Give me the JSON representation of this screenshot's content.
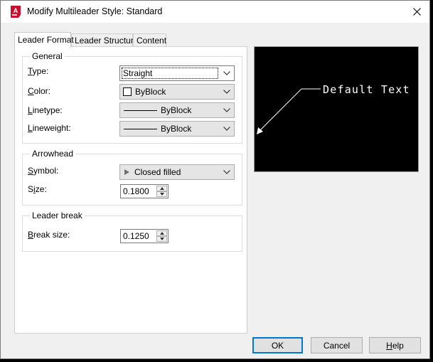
{
  "window": {
    "title": "Modify Multileader Style: Standard",
    "app_icon": "autocad-icon",
    "accent_color": "#c8102e"
  },
  "tabs": [
    {
      "label": "Leader Format",
      "active": true
    },
    {
      "label": "Leader Structure",
      "active": false
    },
    {
      "label": "Content",
      "active": false
    }
  ],
  "general": {
    "title": "General",
    "type": {
      "label": "Type:",
      "mnemonic": "T",
      "rest": "ype:",
      "value": "Straight"
    },
    "color": {
      "label": "Color:",
      "mnemonic": "C",
      "rest": "olor:",
      "value": "ByBlock"
    },
    "linetype": {
      "label": "Linetype:",
      "mnemonic": "L",
      "rest": "inetype:",
      "value": "ByBlock"
    },
    "lineweight": {
      "label": "Lineweight:",
      "mnemonic": "L",
      "rest": "ineweight:",
      "value": "ByBlock"
    }
  },
  "arrowhead": {
    "title": "Arrowhead",
    "symbol": {
      "label": "Symbol:",
      "mnemonic": "S",
      "rest": "ymbol:",
      "value": "Closed filled"
    },
    "size": {
      "label": "Size:",
      "pre": "S",
      "mnemonic": "i",
      "rest": "ze:",
      "value": "0.1800"
    }
  },
  "leader_break": {
    "title": "Leader break",
    "break_size": {
      "label": "Break size:",
      "mnemonic": "B",
      "rest": "reak size:",
      "value": "0.1250"
    }
  },
  "preview": {
    "text": "Default Text"
  },
  "buttons": {
    "ok": "OK",
    "cancel": "Cancel",
    "help_mnemonic": "H",
    "help_rest": "elp"
  }
}
